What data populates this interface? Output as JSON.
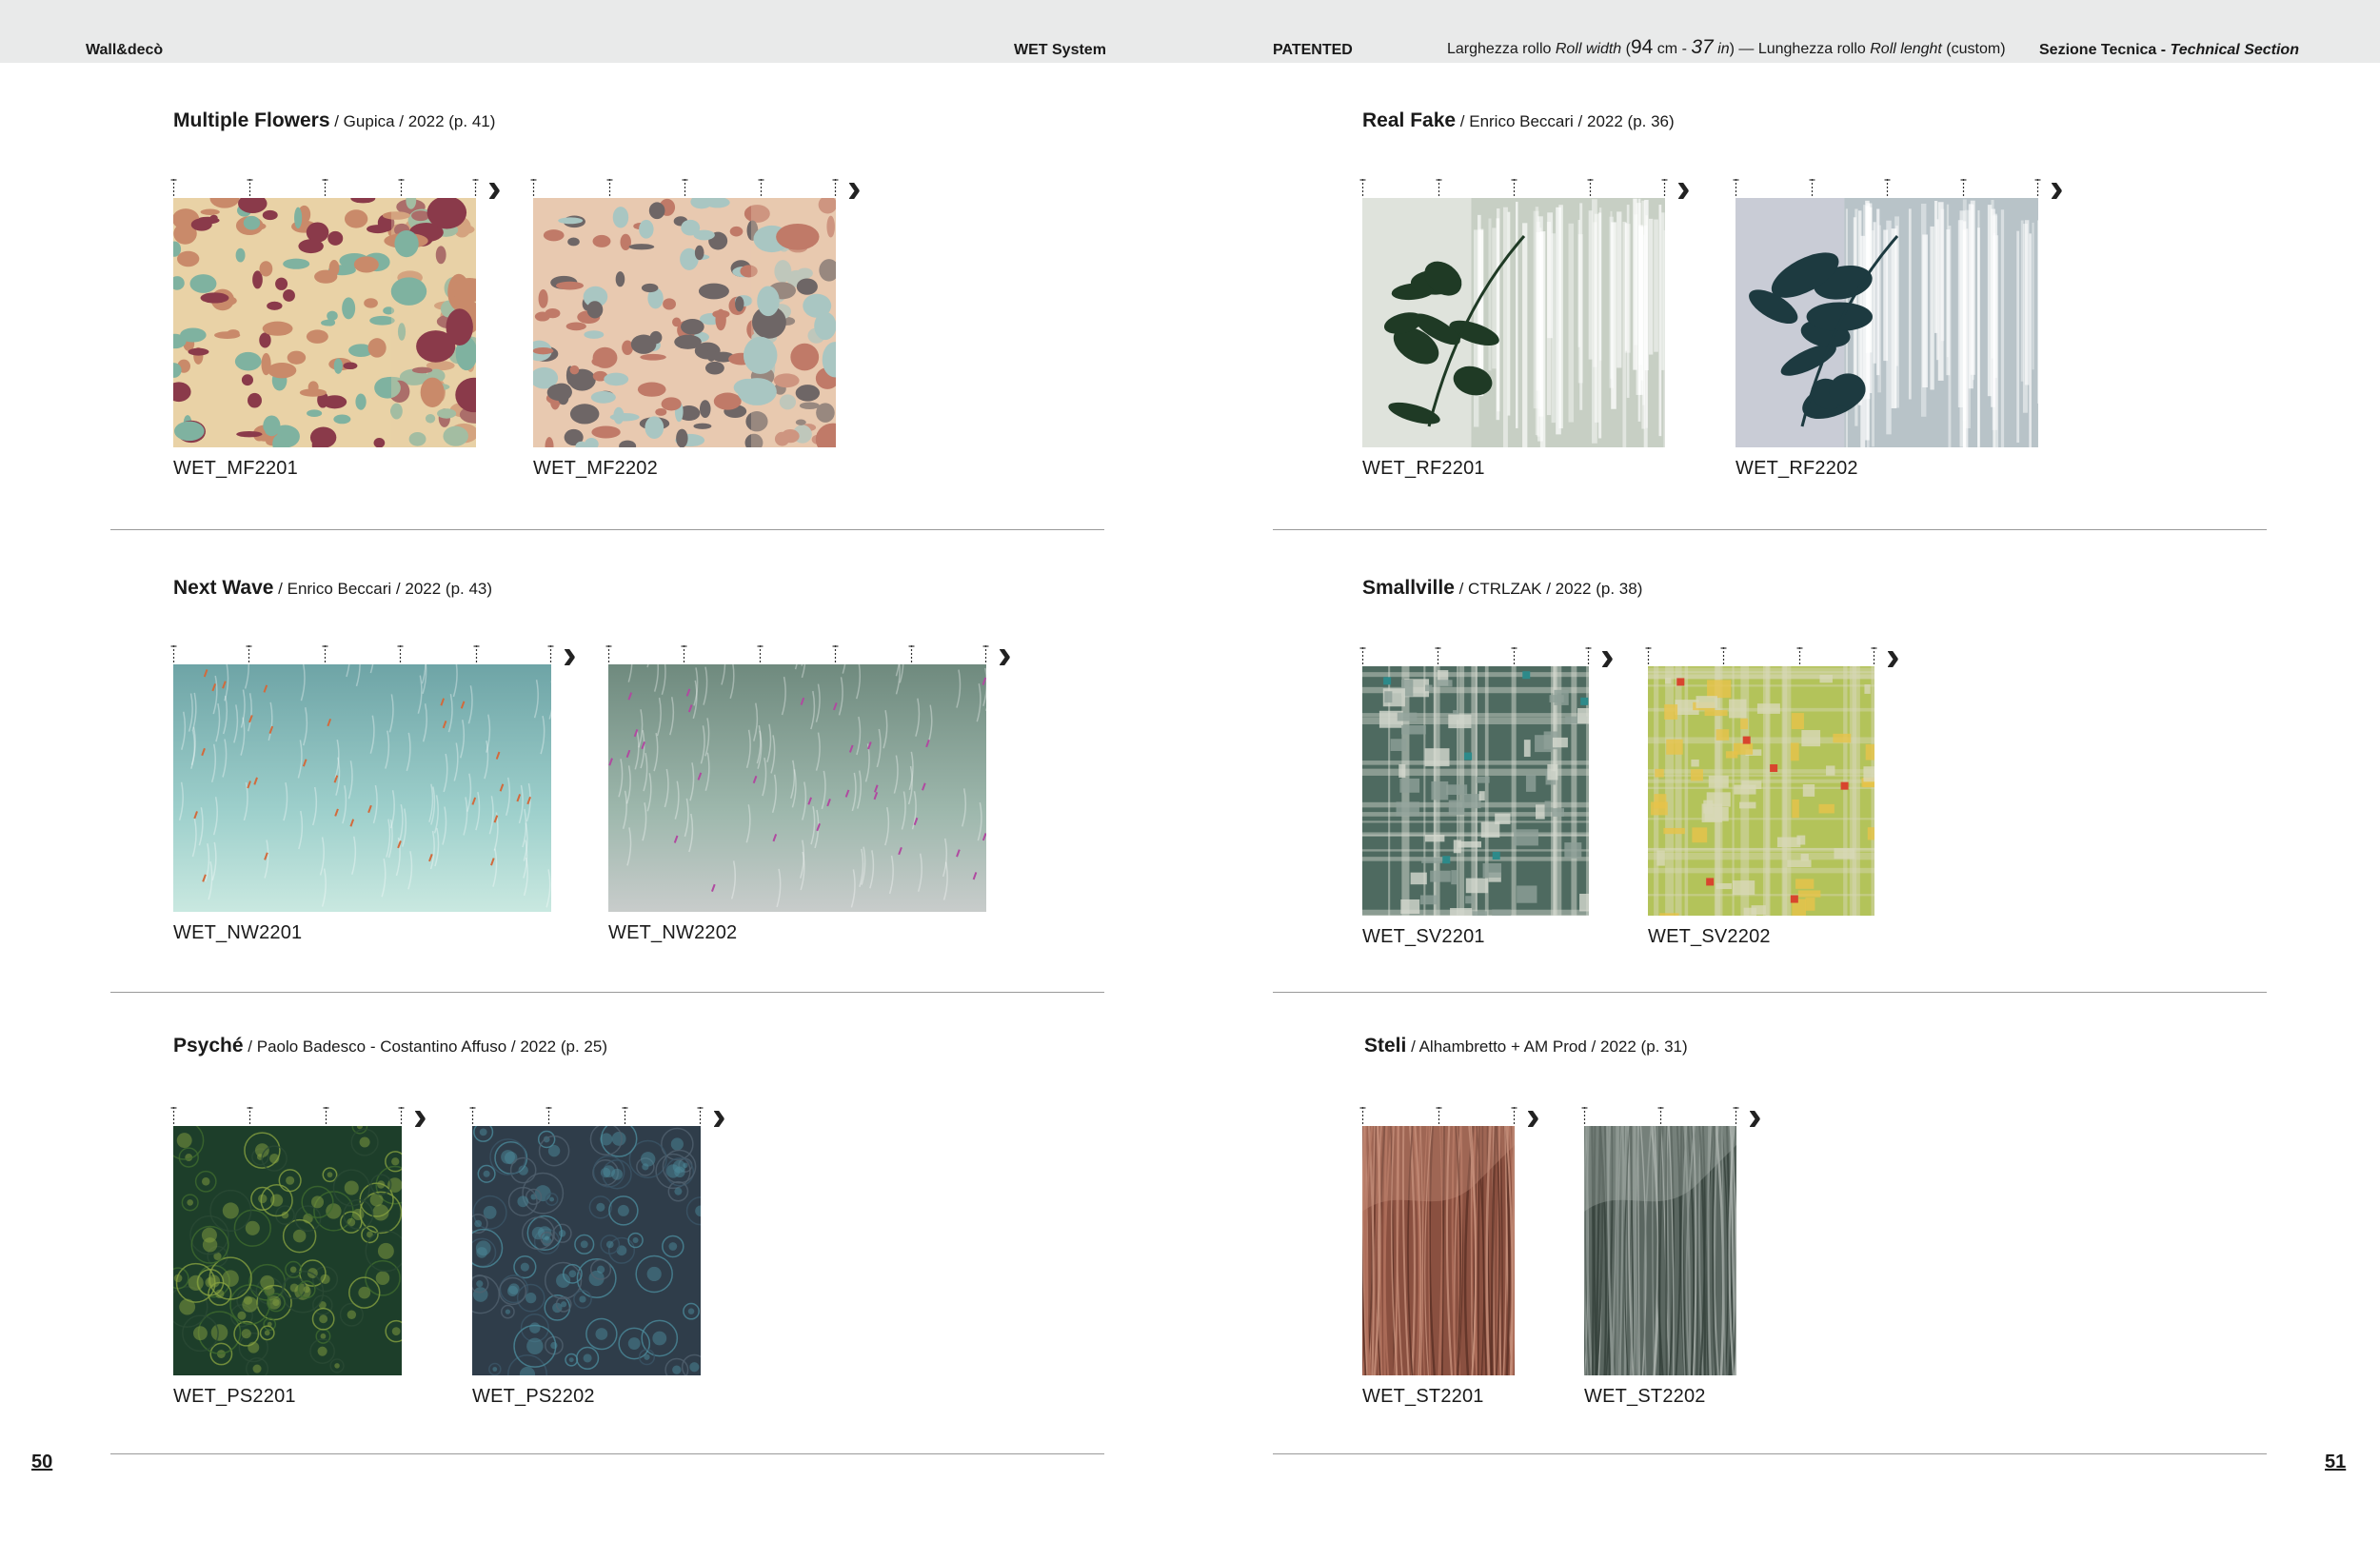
{
  "header": {
    "brand": "Wall&decò",
    "system": "WET System",
    "patented": "PATENTED",
    "roll_prefix": "Larghezza rollo ",
    "roll_width_en": "Roll width",
    "roll_open": " (",
    "roll_cm": "94",
    "roll_cm_unit": " cm - ",
    "roll_in": "37",
    "roll_in_unit": " in",
    "roll_close": ") — Lunghezza rollo ",
    "roll_length_en": "Roll lenght",
    "roll_custom": " (custom)",
    "section_it": "Sezione Tecnica - ",
    "section_en": "Technical Section"
  },
  "sections": [
    {
      "name": "Multiple Flowers",
      "meta": " / Gupica / 2022 (p. 41)",
      "items": [
        {
          "code": "WET_MF2201",
          "colors": [
            "#e9d2a6",
            "#8a3a4a",
            "#7fb2a0",
            "#c98a6a"
          ]
        },
        {
          "code": "WET_MF2202",
          "colors": [
            "#e8c9b0",
            "#c07a68",
            "#a9c6c2",
            "#6e6666"
          ]
        }
      ]
    },
    {
      "name": "Real Fake",
      "meta": " / Enrico Beccari / 2022 (p. 36)",
      "items": [
        {
          "code": "WET_RF2201",
          "colors": [
            "#dfe3dc",
            "#c7cfc4",
            "#1f3a25",
            "#ffffff"
          ]
        },
        {
          "code": "WET_RF2202",
          "colors": [
            "#c9ccd6",
            "#b8c3c8",
            "#1d3a40",
            "#ffffff"
          ]
        }
      ]
    },
    {
      "name": "Next Wave",
      "meta": " / Enrico Beccari / 2022 (p. 43)",
      "items": [
        {
          "code": "WET_NW2201",
          "colors": [
            "#6ea4a6",
            "#9ed0cc",
            "#c9e8e0",
            "#d26a3c"
          ]
        },
        {
          "code": "WET_NW2202",
          "colors": [
            "#6f8a7e",
            "#9eb8ad",
            "#c8cccb",
            "#b04aa0"
          ]
        }
      ]
    },
    {
      "name": "Smallville",
      "meta": " / CTRLZAK / 2022 (p. 38)",
      "items": [
        {
          "code": "WET_SV2201",
          "colors": [
            "#4e6a60",
            "#8ea098",
            "#d6d9d0",
            "#2d8a8a"
          ]
        },
        {
          "code": "WET_SV2202",
          "colors": [
            "#b3c35a",
            "#e7c34a",
            "#d8d8b8",
            "#d8452e"
          ]
        }
      ]
    },
    {
      "name": "Psyché",
      "meta": " / Paolo Badesco - Costantino Affuso / 2022 (p. 25)",
      "items": [
        {
          "code": "WET_PS2201",
          "colors": [
            "#1d3e2a",
            "#3f6a2e",
            "#86a040",
            "#2a4a34"
          ]
        },
        {
          "code": "WET_PS2202",
          "colors": [
            "#2f3d4a",
            "#3b5566",
            "#4b8a9a",
            "#50606e"
          ]
        }
      ]
    },
    {
      "name": "Steli",
      "meta": " / Alhambretto + AM Prod / 2022 (p. 31)",
      "items": [
        {
          "code": "WET_ST2201",
          "colors": [
            "#8a5040",
            "#b0705c",
            "#5a3024",
            "#c7907a"
          ]
        },
        {
          "code": "WET_ST2202",
          "colors": [
            "#5a6660",
            "#8a948e",
            "#33403a",
            "#aab2ac"
          ]
        }
      ]
    }
  ],
  "pages": {
    "left": "50",
    "right": "51"
  }
}
